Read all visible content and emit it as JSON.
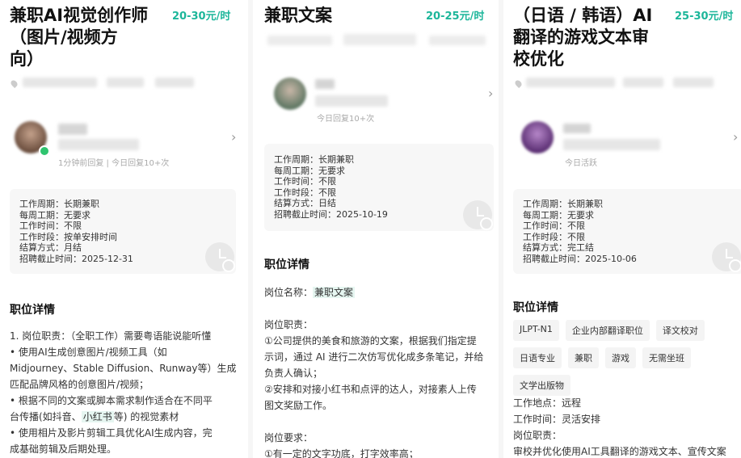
{
  "cards": [
    {
      "title_lines": [
        "兼职AI视觉创作师",
        "（图片/视频方",
        "向）"
      ],
      "salary": "20-30元/时",
      "reply": "1分钟前回复 | 今日回复10+次",
      "info": [
        "工作周期：长期兼职",
        "每周工期：无要求",
        "工作时间：不限",
        "工作时段：按单安排时间",
        "结算方式：月结",
        "招聘截止时间：2025-12-31"
      ],
      "section_title": "职位详情",
      "body": [
        "1.  岗位职责：（全职工作）需要粤语能说能听懂",
        "  •  使用AI生成创意图片/视频工具（如",
        "Midjourney、Stable Diffusion、Runway等）生成",
        "匹配品牌风格的创意图片/视频；",
        "  •  根据不同的文案或脚本需求制作适合在不同平",
        "台传播(如抖音、",
        "小红书",
        "等) 的视觉素材",
        "  •  使用相片及影片剪辑工具优化AI生成内容，完",
        "成基础剪辑及后期处理。"
      ]
    },
    {
      "title_lines": [
        "兼职文案"
      ],
      "salary": "20-25元/时",
      "reply": "今日回复10+次",
      "info": [
        "工作周期：长期兼职",
        "每周工期：无要求",
        "工作时间：不限",
        "工作时段：不限",
        "结算方式：日结",
        "招聘截止时间：2025-10-19"
      ],
      "section_title": "职位详情",
      "position_label": "岗位名称：",
      "position_value": "兼职文案",
      "duties_title": "岗位职责：",
      "duties": [
        "①公司提供的美食和旅游的文案，根据我们指定提",
        "示词，通过 AI 进行二次仿写优化成多条笔记，并给",
        "负责人确认；",
        "②安排和对接小红书和点评的达人，对接素人上传",
        "图文奖励工作。"
      ],
      "req_title": "岗位要求：",
      "req": [
        "①有一定的文字功底，打字效率高；"
      ]
    },
    {
      "title_lines": [
        "（日语 / 韩语）AI",
        "翻译的游戏文本审",
        "校优化"
      ],
      "salary": "25-30元/时",
      "reply": "今日活跃",
      "info": [
        "工作周期：长期兼职",
        "每周工期：无要求",
        "工作时间：不限",
        "工作时段：不限",
        "结算方式：完工结",
        "招聘截止时间：2025-10-06"
      ],
      "section_title": "职位详情",
      "tags": [
        "JLPT-N1",
        "企业内部翻译职位",
        "译文校对",
        "日语专业",
        "兼职",
        "游戏",
        "无需坐班",
        "文学出版物"
      ],
      "lines": [
        "工作地点：远程",
        "工作时间：灵活安排",
        "岗位职责：",
        "审校并优化使用AI工具翻译的游戏文本、宣传文案"
      ]
    }
  ],
  "icons": {
    "chevron": "›"
  },
  "colors": {
    "salary": "#1cb69a",
    "highlight_bg": "#e6f6f1",
    "online": "#2fc46f"
  }
}
